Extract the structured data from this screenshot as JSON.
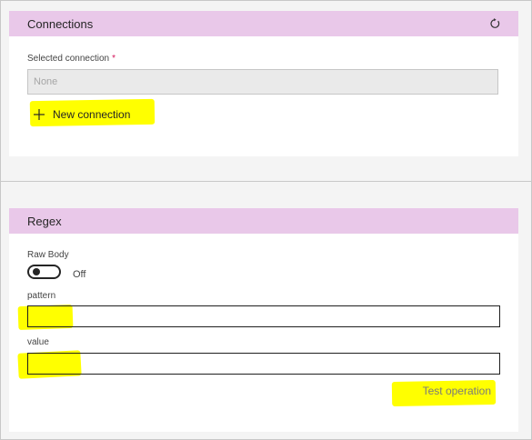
{
  "connections": {
    "title": "Connections",
    "refresh_icon": "refresh-icon",
    "selected_label": "Selected connection",
    "required_mark": "*",
    "selected_value": "None",
    "new_connection_label": "New connection",
    "plus_icon": "plus-icon"
  },
  "regex": {
    "title": "Regex",
    "raw_body_label": "Raw Body",
    "raw_body_state": "Off",
    "pattern_label": "pattern",
    "pattern_value": "",
    "value_label": "value",
    "value_value": "",
    "test_button_label": "Test operation"
  },
  "colors": {
    "header_bg": "#e9c8e9",
    "highlight": "#ffff00",
    "required": "#d4145a"
  }
}
